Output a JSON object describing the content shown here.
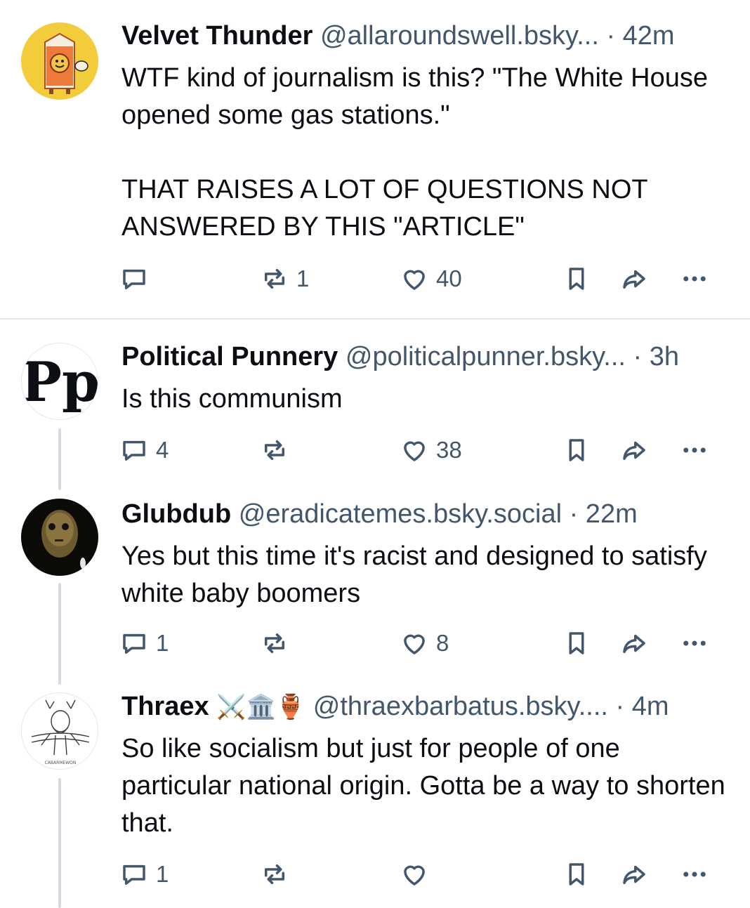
{
  "colors": {
    "text": "#0b0f14",
    "secondary": "#42576c",
    "divider": "#e2e7ec",
    "thread_line": "#d4dbe2"
  },
  "posts": [
    {
      "name": "Velvet Thunder",
      "handle": "@allaroundswell.bsky...",
      "time": "· 42m",
      "avatar_icon": "milk-carton-mascot",
      "text": "WTF kind of journalism is this?  \"The White House opened some gas stations.\"\n\nTHAT RAISES A LOT OF QUESTIONS NOT ANSWERED BY THIS \"ARTICLE\"",
      "replies": "",
      "reposts": "1",
      "likes": "40"
    },
    {
      "name": "Political Punnery",
      "handle": "@politicalpunner.bsky...",
      "time": "· 3h",
      "avatar_icon": "pp-monogram",
      "avatar_text": "Pp",
      "text": "Is this communism",
      "replies": "4",
      "reposts": "",
      "likes": "38"
    },
    {
      "name": "Glubdub",
      "handle": "@eradicatemes.bsky.social",
      "time": "· 22m",
      "avatar_icon": "dark-face",
      "text": "Yes but this time it's racist and designed to satisfy white baby boomers",
      "replies": "1",
      "reposts": "",
      "likes": "8"
    },
    {
      "name": "Thraex",
      "name_emoji": "⚔️🏛️🏺",
      "handle": "@thraexbarbatus.bsky....",
      "time": "· 4m",
      "avatar_icon": "sketched-warrior",
      "avatar_caption": "CABARMEWON",
      "text": "So like socialism but just for people of one particular national origin. Gotta be a way to shorten that.",
      "replies": "1",
      "reposts": "",
      "likes": ""
    }
  ]
}
